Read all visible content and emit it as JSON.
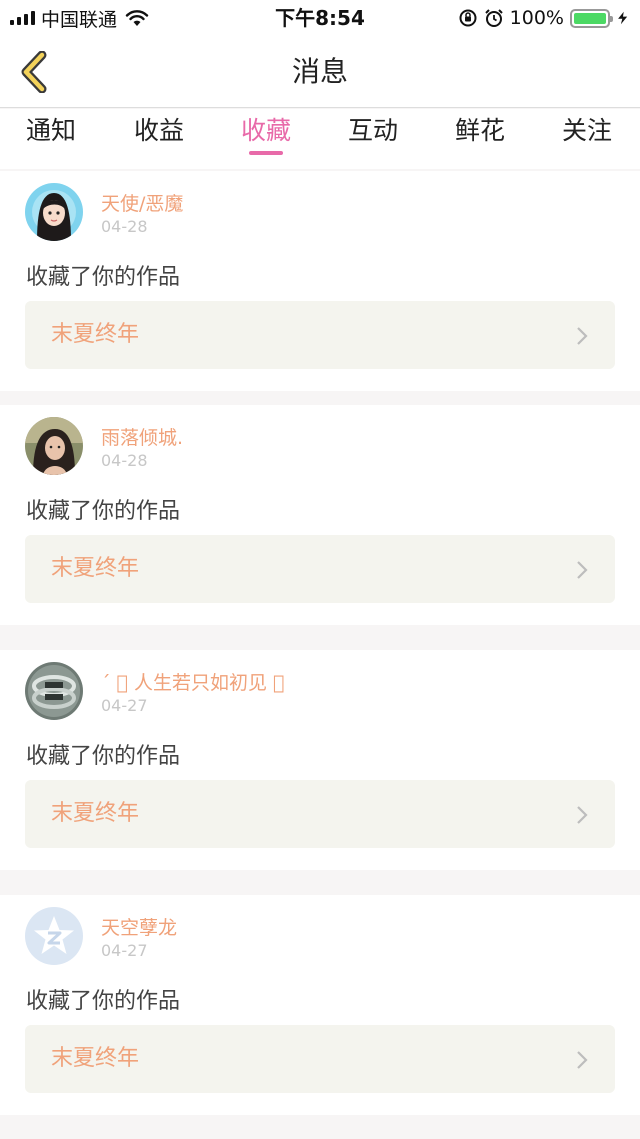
{
  "status_bar": {
    "carrier": "中国联通",
    "time": "下午8:54",
    "battery": "100%"
  },
  "header": {
    "title": "消息"
  },
  "tabs": [
    {
      "label": "通知",
      "active": false
    },
    {
      "label": "收益",
      "active": false
    },
    {
      "label": "收藏",
      "active": true
    },
    {
      "label": "互动",
      "active": false
    },
    {
      "label": "鲜花",
      "active": false
    },
    {
      "label": "关注",
      "active": false
    }
  ],
  "accent_color": "#e86aa9",
  "name_color": "#f0a27a",
  "messages": [
    {
      "user": "天使/恶魔",
      "date": "04-28",
      "action": "收藏了你的作品",
      "work": "末夏终年",
      "avatar_icon": "cartoon-girl-avatar-icon"
    },
    {
      "user": "雨落倾城.",
      "date": "04-28",
      "action": "收藏了你的作品",
      "work": "末夏终年",
      "avatar_icon": "photo-avatar-icon"
    },
    {
      "user": "ˊ ゙ 人生若只如初见 ゙",
      "date": "04-27",
      "action": "收藏了你的作品",
      "work": "末夏终年",
      "avatar_icon": "ring-photo-avatar-icon"
    },
    {
      "user": "天空孽龙",
      "date": "04-27",
      "action": "收藏了你的作品",
      "work": "末夏终年",
      "avatar_icon": "default-qzone-avatar-icon"
    }
  ]
}
